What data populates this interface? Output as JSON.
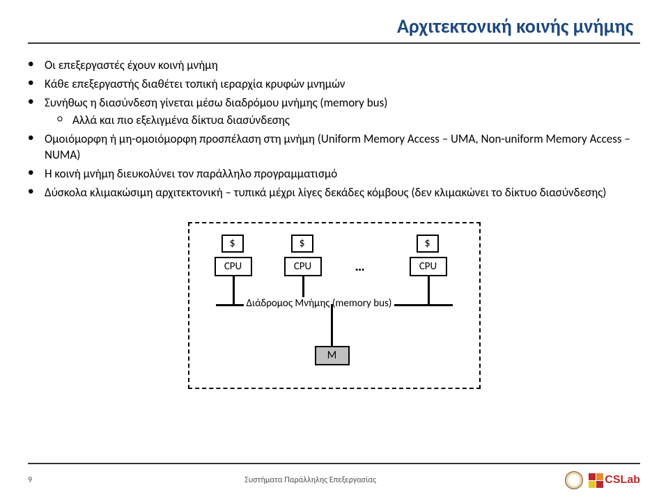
{
  "title": "Αρχιτεκτονική κοινής μνήμης",
  "bullets": [
    {
      "text": "Οι επεξεργαστές έχουν κοινή μνήμη"
    },
    {
      "text": "Κάθε επεξεργαστής διαθέτει τοπική ιεραρχία κρυφών μνημών"
    },
    {
      "text": "Συνήθως η διασύνδεση γίνεται μέσω διαδρόμου μνήμης (memory bus)",
      "sub": [
        "Αλλά και πιο εξελιγμένα δίκτυα διασύνδεσης"
      ]
    },
    {
      "text": "Ομοιόμορφη ή μη-ομοιόμορφη προσπέλαση στη μνήμη (Uniform Memory Access – UMA, Non-uniform Memory Access – NUMA)"
    },
    {
      "text": "Η κοινή μνήμη διευκολύνει τον παράλληλο προγραμματισμό"
    },
    {
      "text": "Δύσκολα κλιμακώσιμη αρχιτεκτονική – τυπικά μέχρι λίγες δεκάδες κόμβους (δεν κλιμακώνει το δίκτυο διασύνδεσης)"
    }
  ],
  "diagram": {
    "cache": "$",
    "cpu": "CPU",
    "dots": "…",
    "bus_label": "Διάδρομος Μνήμης (memory bus)",
    "mem": "M"
  },
  "footer": {
    "page": "9",
    "text": "Συστήματα Παράλληλης Επεξεργασίας",
    "cslab": "CSLab"
  }
}
